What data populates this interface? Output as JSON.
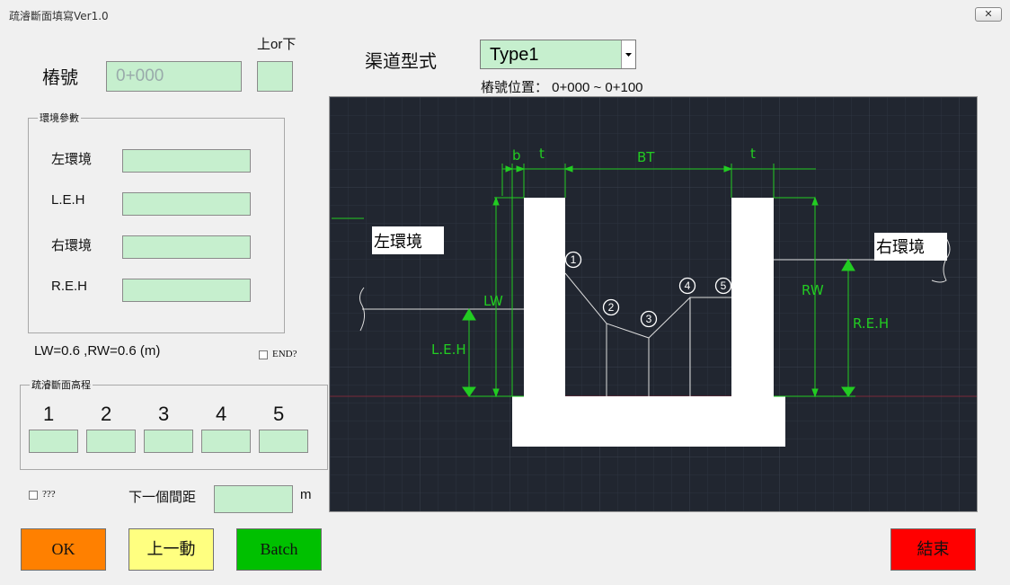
{
  "window": {
    "title": "疏濬斷面填寫Ver1.0",
    "close_glyph": "✕"
  },
  "station": {
    "label": "樁號",
    "value": "0+000",
    "updown_label": "上or下",
    "updown_value": ""
  },
  "channel": {
    "label": "渠道型式",
    "selected": "Type1",
    "range_text": "樁號位置： 0+000 ~ 0+100"
  },
  "env": {
    "group_title": "環境參數",
    "left_env_label": "左環境",
    "left_env_value": "",
    "leh_label": "L.E.H",
    "leh_value": "",
    "right_env_label": "右環境",
    "right_env_value": "",
    "reh_label": "R.E.H",
    "reh_value": ""
  },
  "wall_text": "LW=0.6 ,RW=0.6 (m)",
  "end_check": {
    "label": "END?"
  },
  "dredge": {
    "group_title": "疏濬斷面高程",
    "points": [
      {
        "label": "1",
        "value": ""
      },
      {
        "label": "2",
        "value": ""
      },
      {
        "label": "3",
        "value": ""
      },
      {
        "label": "4",
        "value": ""
      },
      {
        "label": "5",
        "value": ""
      }
    ]
  },
  "unknown_check": {
    "label": "???"
  },
  "next_spacing": {
    "label": "下一個間距",
    "value": "",
    "unit": "m"
  },
  "buttons": {
    "ok": "OK",
    "prev": "上一動",
    "batch": "Batch",
    "exit": "結束"
  },
  "colors": {
    "field_green": "#c6efce",
    "ok": "#ff8000",
    "prev": "#ffff80",
    "batch": "#00c000",
    "exit": "#ff0000",
    "cad_bg": "#212630",
    "dim_green": "#22cc22"
  },
  "diagram": {
    "dim_b": "b",
    "dim_t_left": "t",
    "dim_bt": "BT",
    "dim_t_right": "t",
    "lw": "LW",
    "rw": "RW",
    "leh": "L.E.H",
    "reh": "R.E.H",
    "left_env": "左環境",
    "right_env": "右環境",
    "p1": "1",
    "p2": "2",
    "p3": "3",
    "p4": "4",
    "p5": "5"
  }
}
